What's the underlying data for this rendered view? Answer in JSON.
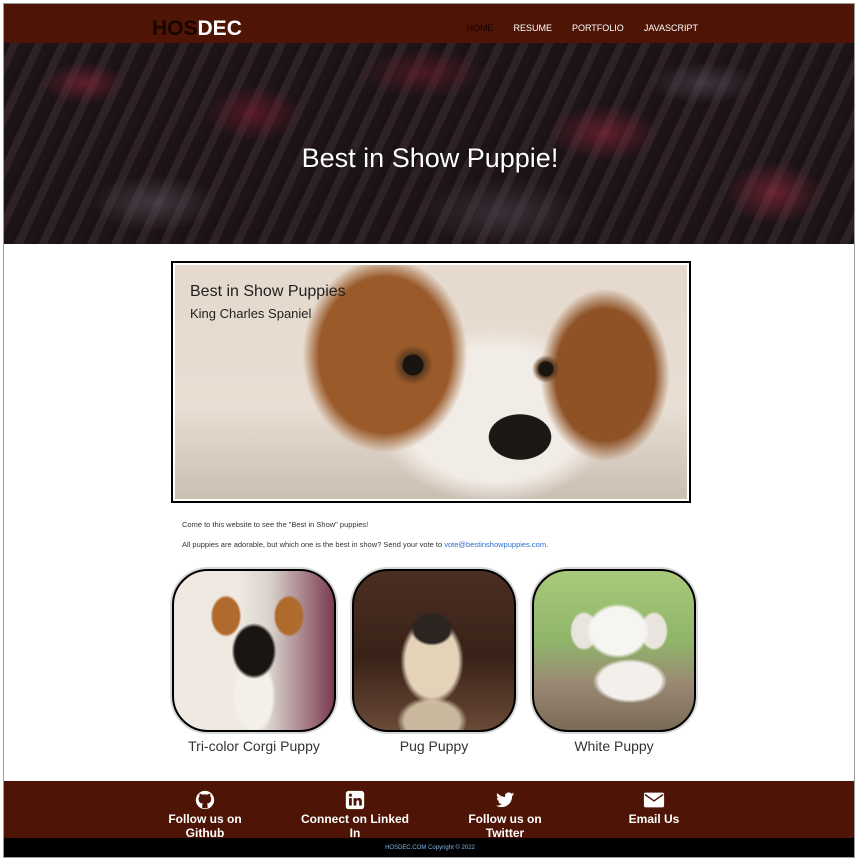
{
  "nav": {
    "brand_hos": "HOS",
    "brand_dec": "DEC",
    "items": [
      {
        "label": "HOME"
      },
      {
        "label": "RESUME"
      },
      {
        "label": "PORTFOLIO"
      },
      {
        "label": "JAVASCRIPT"
      }
    ]
  },
  "hero": {
    "title": "Best in Show Puppie!"
  },
  "featured": {
    "title": "Best in Show Puppies",
    "subtitle": "King Charles Spaniel"
  },
  "intro": {
    "line1": "Come to this website to see the \"Best in Show\" puppies!",
    "line2": "All puppies are adorable, but which one is the best in show? Send your vote to ",
    "email": "vote@bestinshowpuppies.com",
    "line2_end": "."
  },
  "cards": [
    {
      "caption": "Tri-color Corgi Puppy"
    },
    {
      "caption": "Pug Puppy"
    },
    {
      "caption": "White Puppy"
    }
  ],
  "footer": {
    "links": [
      {
        "label": "Follow us on Github",
        "icon": "github-icon"
      },
      {
        "label": "Connect on Linked In",
        "icon": "linkedin-icon"
      },
      {
        "label": "Follow us on Twitter",
        "icon": "twitter-icon"
      },
      {
        "label": "Email Us",
        "icon": "envelope-icon"
      }
    ],
    "copyright": "HOSDEC.COM Copyright © 2022"
  },
  "colors": {
    "navbar_bg": "#4e1406",
    "link": "#2a6fd0",
    "copyright_text": "#7fb2e5"
  }
}
